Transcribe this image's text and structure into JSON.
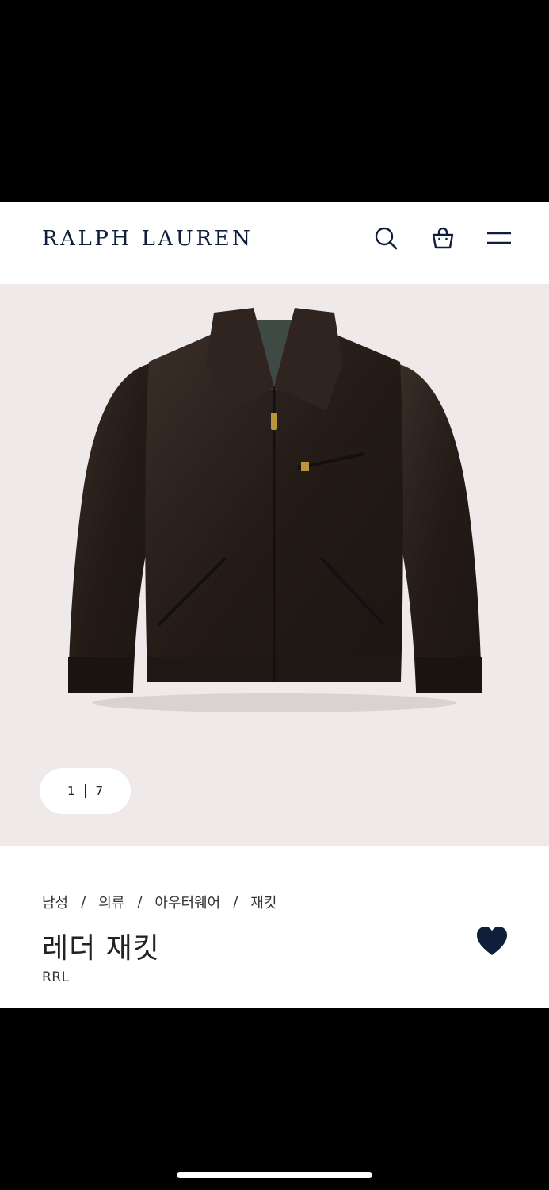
{
  "header": {
    "logo": "RALPH LAUREN",
    "icons": [
      "search-icon",
      "shopping-bag-icon",
      "menu-icon"
    ]
  },
  "gallery": {
    "current": "1",
    "total": "7",
    "background": "#efe9e9"
  },
  "product": {
    "breadcrumb": [
      "남성",
      "의류",
      "아우터웨어",
      "재킷"
    ],
    "breadcrumb_separator": "/",
    "name": "레더 재킷",
    "brand": "RRL",
    "favorited": true,
    "heart_color": "#0f1e3a"
  }
}
